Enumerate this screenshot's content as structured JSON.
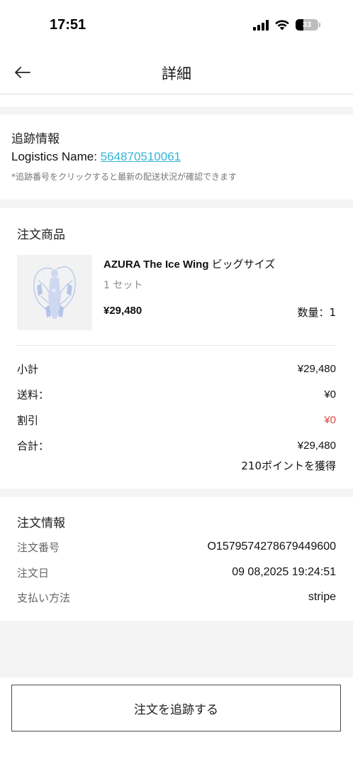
{
  "status_bar": {
    "time": "17:51",
    "battery": "33",
    "battery_level": 0.33
  },
  "nav": {
    "title": "詳細"
  },
  "tracking": {
    "title": "追跡情報",
    "logistics_label": "Logistics Name: ",
    "tracking_number": "564870510061",
    "note": "*追跡番号をクリックすると最新の配送状況が確認できます"
  },
  "order_items": {
    "title": "注文商品",
    "product": {
      "name": "AZURA The Ice Wing ",
      "name_suffix": "ビッグサイズ",
      "set_label": "1 セット",
      "price": "¥29,480",
      "quantity": "数量：1"
    },
    "summary": {
      "subtotal_label": "小計",
      "subtotal": "¥29,480",
      "shipping_label": "送料：",
      "shipping": "¥0",
      "discount_label": "割引",
      "discount": "¥0",
      "total_label": "合計：",
      "total": "¥29,480",
      "points": "210ポイントを獲得"
    }
  },
  "order_info": {
    "title": "注文情報",
    "number_label": "注文番号",
    "number": "O1579574278679449600",
    "date_label": "注文日",
    "date": "09 08,2025 19:24:51",
    "payment_label": "支払い方法",
    "payment": "stripe"
  },
  "footer": {
    "track_button": "注文を追跡する"
  }
}
